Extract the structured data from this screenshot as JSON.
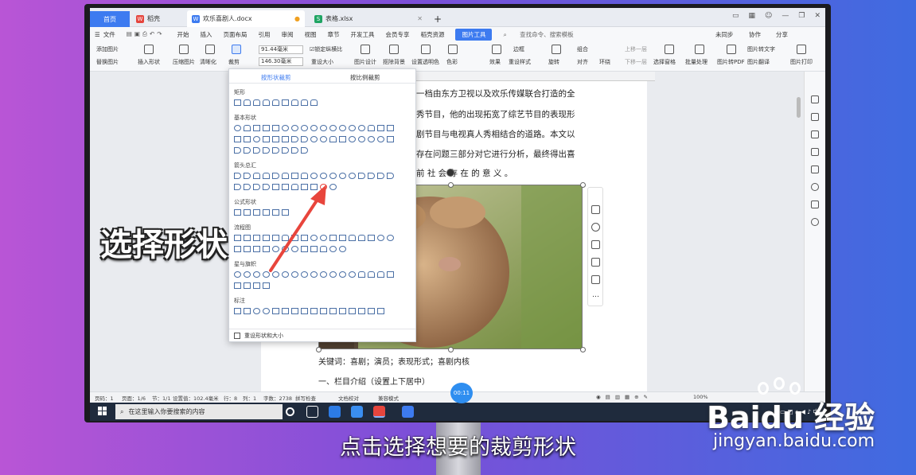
{
  "tabs": {
    "home": "首页",
    "daoke": "稻壳",
    "doc": "欢乐喜剧人.docx",
    "xlsx": "表格.xlsx",
    "new": "+"
  },
  "menu": {
    "file": "文件",
    "items": [
      "开始",
      "插入",
      "页面布局",
      "引用",
      "审阅",
      "视图",
      "章节",
      "开发工具",
      "会员专享",
      "稻壳资源"
    ],
    "pictool": "图片工具",
    "search": "查找命令、搜索模板",
    "right": [
      "未同步",
      "协作",
      "分享"
    ]
  },
  "ribbon": {
    "add_pic": "添加图片",
    "replace_pic": "替换图片",
    "insert_shape": "插入形状",
    "compress": "压缩图片",
    "clarify": "清晰化",
    "crop": "裁剪",
    "width": "91.44毫米",
    "height": "146.30毫米",
    "lock_ratio": "锁定纵横比",
    "reset_size": "重设大小",
    "pic_design": "图片设计",
    "remove_bg": "抠除背景",
    "transparent": "设置透明色",
    "color": "色彩",
    "effect": "效果",
    "reset_style": "重设样式",
    "border": "边框",
    "rotate": "旋转",
    "group": "组合",
    "align": "对齐",
    "wrap": "环绕",
    "up_layer": "上移一层",
    "down_layer": "下移一层",
    "select_pane": "选择窗格",
    "batch": "批量处理",
    "to_pdf": "图片转PDF",
    "to_text": "图片转文字",
    "translate": "图片翻译",
    "print": "图片打印"
  },
  "dropdown": {
    "tab_shape": "按形状裁剪",
    "tab_ratio": "按比例裁剪",
    "sections": [
      "矩形",
      "基本形状",
      "箭头总汇",
      "公式形状",
      "流程图",
      "星与旗帜",
      "标注"
    ],
    "reset": "重设形状和大小"
  },
  "document": {
    "lines": [
      "一档由东方卫视以及欢乐传媒联合打造的全",
      "秀节目，他的出现拓宽了综艺节目的表现形",
      "剧节目与电视真人秀相结合的道路。本文以",
      "存在问题三部分对它进行分析，最终得出喜",
      "前  社  会  存  在  的  意  义  。"
    ],
    "keywords": "关键词：喜剧；演员；表现形式；喜剧内核",
    "heading": "一、栏目介绍（设置上下居中）"
  },
  "status": {
    "page": "页码：1",
    "pages": "页面：1/6",
    "section": "节：1/1",
    "setting": "设置值：102.4毫米",
    "row": "行：8",
    "col": "列：1",
    "words": "字数：2738",
    "spell": "拼写检查",
    "proof": "文档校对",
    "compat": "兼容模式",
    "zoom": "100%"
  },
  "taskbar": {
    "search": "在这里输入你要搜索的内容",
    "tray": "中"
  },
  "overlay": {
    "label": "选择形状",
    "timer": "00:11",
    "subtitle": "点击选择想要的裁剪形状"
  },
  "watermark": {
    "brand": "Baidu 经验",
    "url": "jingyan.baidu.com"
  },
  "colors": {
    "accent": "#3d7bf0",
    "arrow": "#e8453c"
  }
}
